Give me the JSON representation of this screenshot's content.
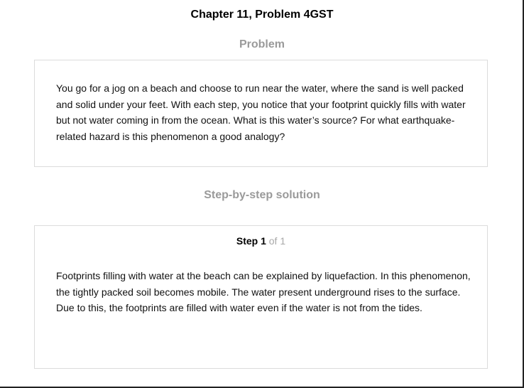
{
  "header": {
    "title": "Chapter 11, Problem 4GST"
  },
  "problem": {
    "heading": "Problem",
    "text": "You go for a jog on a beach and choose to run near the water, where the sand is well packed and solid under your feet. With each step, you notice that your footprint quickly fills with water but not water coming in from the ocean. What is this water’s source? For what earthquake-related hazard is this phenomenon a good analogy?"
  },
  "solution": {
    "heading": "Step-by-step solution",
    "step_label": "Step 1",
    "step_of": "of 1",
    "text": "Footprints filling with water at the beach can be explained by liquefaction. In this phenomenon, the tightly packed soil becomes mobile. The water present underground rises to the surface. Due to this, the footprints are filled with water even if the water is not from the tides."
  },
  "colors": {
    "heading_gray": "#9a9a9a",
    "card_border": "#dcdcdc",
    "step_of_gray": "#a8a8a8"
  }
}
